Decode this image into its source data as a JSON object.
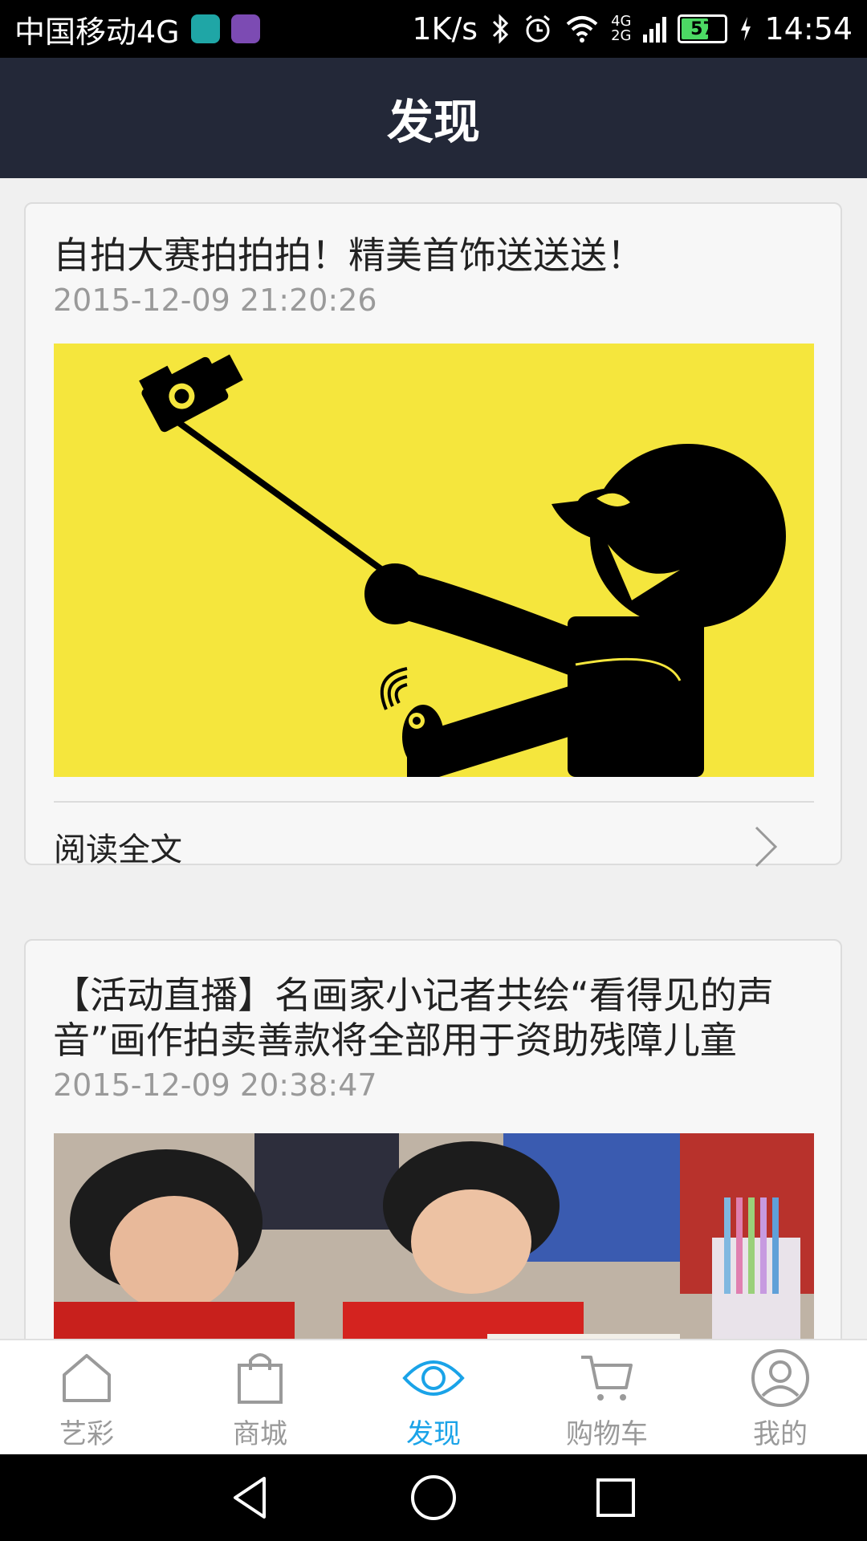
{
  "status_bar": {
    "carrier": "中国移动4G",
    "speed": "1K/s",
    "net_top": "4G",
    "net_bottom": "2G",
    "battery": "57",
    "time": "14:54"
  },
  "header": {
    "title": "发现"
  },
  "articles": [
    {
      "title": "自拍大赛拍拍拍！精美首饰送送送！",
      "date": "2015-12-09 21:20:26",
      "read_more": "阅读全文"
    },
    {
      "title": "【活动直播】名画家小记者共绘“看得见的声音”画作拍卖善款将全部用于资助残障儿童",
      "date": "2015-12-09 20:38:47"
    }
  ],
  "bottom_nav": [
    {
      "label": "艺彩",
      "icon": "home-icon"
    },
    {
      "label": "商城",
      "icon": "shopping-bag-icon"
    },
    {
      "label": "发现",
      "icon": "eye-icon",
      "active": true
    },
    {
      "label": "购物车",
      "icon": "cart-icon"
    },
    {
      "label": "我的",
      "icon": "profile-icon"
    }
  ],
  "colors": {
    "header_bg": "#232838",
    "accent": "#1aa3e8",
    "image_yellow": "#f5e63d"
  }
}
